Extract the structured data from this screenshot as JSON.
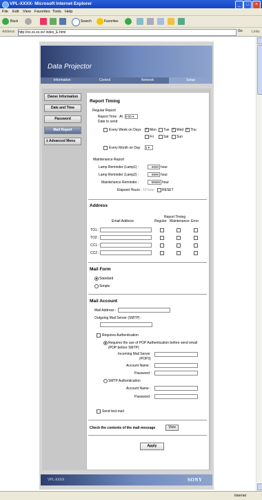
{
  "window": {
    "title": "VPL-XXXX- Microsoft Internet Explorer",
    "menu": [
      "File",
      "Edit",
      "View",
      "Favorites",
      "Tools",
      "Help"
    ],
    "toolbar": {
      "back": "Back",
      "search": "Search",
      "favorites": "Favorites"
    },
    "address_label": "Address",
    "address_value": "http://xx.xx.xx.xx/ index_E.html",
    "go": "Go",
    "links": "Links",
    "status_zone": "Internet"
  },
  "header": {
    "product": "Data Projector",
    "tabs": [
      "Information",
      "Control",
      "Network",
      "Setup"
    ],
    "active_tab": "Setup"
  },
  "nav": {
    "items": [
      "Owner Information",
      "Date and Time",
      "Password",
      "Mail Report",
      "Advanced Menu"
    ],
    "active": "Mail Report"
  },
  "report": {
    "title": "Report Timing",
    "regular": "Regular Report",
    "time_label": "Report Time : At",
    "time_value": "0:00",
    "date_label": "Date to send",
    "every_week": "Every Week on Days",
    "days_row1": [
      "Mon",
      "Tue",
      "Wed",
      "Thu"
    ],
    "days_row2": [
      "Fri",
      "Sat",
      "Sun"
    ],
    "every_month": "Every Month on Day",
    "month_day": "1",
    "maintenance": "Maintenance Report",
    "lamp1": "Lamp Reminder (Lamp1) :",
    "lamp1_value": "8000",
    "lamp2": "Lamp Reminder (Lamp2) :",
    "lamp2_value": "8999",
    "maint_rem": "Maintenance Reminder :",
    "maint_value": "99999",
    "hour": "hour",
    "elapsed": "Elapsed Hours :",
    "elapsed_value": "10 hour",
    "reset": "RESET"
  },
  "address": {
    "title": "Address",
    "email": "Email Address",
    "timing": "Report Timing",
    "cols": [
      "Regular",
      "Maintenance",
      "Error"
    ],
    "rows": [
      "TO1 :",
      "TO2 :",
      "CC1 :",
      "CC2 :"
    ]
  },
  "form": {
    "title": "Mail Form",
    "standard": "Standard",
    "simple": "Simple"
  },
  "account": {
    "title": "Mail Account",
    "mail_address": "Mail Address :",
    "smtp": "Outgoing Mail Server (SMTP) :",
    "requires_auth": "Requires Authentication",
    "pop_line1": "Requires the use of POP Authentication before send email",
    "pop_line2": "(POP before SMTP)",
    "incoming1": "Incoming Mail Server",
    "incoming2": "(POP3)",
    "account_name": "Account Name :",
    "password": "Password :",
    "smtp_auth": "SMTP Authentication",
    "send_test": "Send test mail"
  },
  "check_label": "Check the contents of the mail message",
  "view_btn": "View",
  "apply_btn": "Apply",
  "footer": {
    "model": "VPL-XXXX",
    "brand": "SONY"
  }
}
